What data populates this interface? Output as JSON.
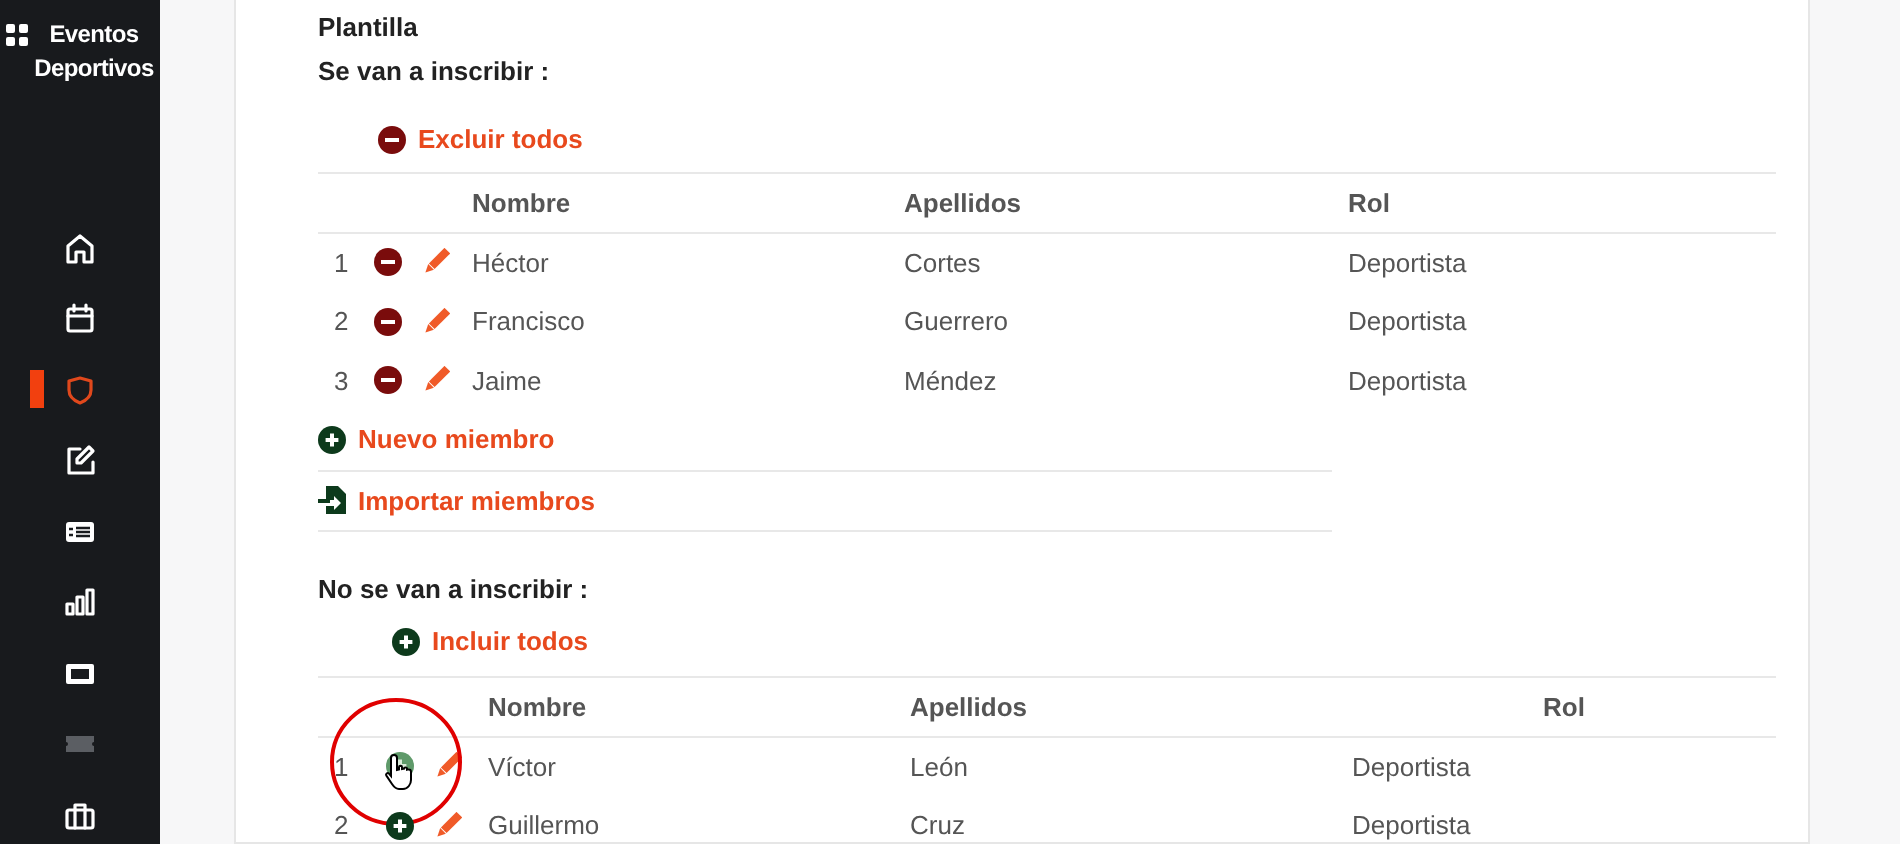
{
  "sidebar": {
    "brand": "Eventos Deportivos",
    "items": [
      {
        "selected": false,
        "disabled": false
      },
      {
        "selected": false,
        "disabled": false
      },
      {
        "selected": true,
        "disabled": false
      },
      {
        "selected": false,
        "disabled": false
      },
      {
        "selected": false,
        "disabled": false
      },
      {
        "selected": false,
        "disabled": false
      },
      {
        "selected": false,
        "disabled": false
      },
      {
        "selected": false,
        "disabled": true
      },
      {
        "selected": false,
        "disabled": false
      }
    ]
  },
  "section_title": "Plantilla",
  "groups": [
    {
      "heading": "Se van a inscribir :",
      "bulk_action": {
        "kind": "exclude",
        "label": "Excluir todos"
      },
      "columns": [
        "Nombre",
        "Apellidos",
        "Rol"
      ],
      "rows": [
        {
          "number": "1",
          "kind": "exclude",
          "hovered": false,
          "name": "Héctor",
          "surname": "Cortes",
          "role": "Deportista"
        },
        {
          "number": "2",
          "kind": "exclude",
          "hovered": false,
          "name": "Francisco",
          "surname": "Guerrero",
          "role": "Deportista"
        },
        {
          "number": "3",
          "kind": "exclude",
          "hovered": false,
          "name": "Jaime",
          "surname": "Méndez",
          "role": "Deportista"
        }
      ],
      "footer_actions": [
        {
          "kind": "add",
          "label": "Nuevo miembro"
        },
        {
          "kind": "import",
          "label": "Importar miembros"
        }
      ]
    },
    {
      "heading": "No se van a inscribir :",
      "bulk_action": {
        "kind": "include",
        "label": "Incluir todos"
      },
      "columns": [
        "Nombre",
        "Apellidos",
        "Rol"
      ],
      "rows": [
        {
          "number": "1",
          "kind": "include",
          "hovered": true,
          "name": "Víctor",
          "surname": "León",
          "role": "Deportista"
        },
        {
          "number": "2",
          "kind": "include",
          "hovered": false,
          "name": "Guillermo",
          "surname": "Cruz",
          "role": "Deportista"
        }
      ]
    }
  ]
}
